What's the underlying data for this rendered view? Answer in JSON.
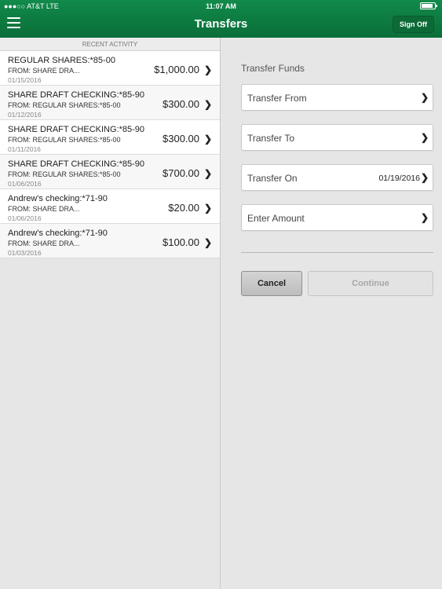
{
  "status_bar": {
    "carrier": "●●●○○ AT&T  LTE",
    "time": "11:07 AM",
    "battery_level": 0.85
  },
  "header": {
    "title": "Transfers",
    "sign_off_label": "Sign Off"
  },
  "recent_activity": {
    "title": "RECENT ACTIVITY",
    "items": [
      {
        "account": "REGULAR SHARES:*85-00",
        "from": "FROM: SHARE DRA...",
        "date": "01/15/2016",
        "amount": "$1,000.00"
      },
      {
        "account": "SHARE DRAFT CHECKING:*85-90",
        "from": "FROM: REGULAR SHARES:*85-00",
        "date": "01/12/2016",
        "amount": "$300.00"
      },
      {
        "account": "SHARE DRAFT CHECKING:*85-90",
        "from": "FROM: REGULAR SHARES:*85-00",
        "date": "01/11/2016",
        "amount": "$300.00"
      },
      {
        "account": "SHARE DRAFT CHECKING:*85-90",
        "from": "FROM: REGULAR SHARES:*85-00",
        "date": "01/06/2016",
        "amount": "$700.00"
      },
      {
        "account": "Andrew's checking:*71-90",
        "from": "FROM: SHARE DRA...",
        "date": "01/06/2016",
        "amount": "$20.00"
      },
      {
        "account": "Andrew's checking:*71-90",
        "from": "FROM: SHARE DRA...",
        "date": "01/03/2016",
        "amount": "$100.00"
      }
    ]
  },
  "form": {
    "title": "Transfer Funds",
    "transfer_from_label": "Transfer From",
    "transfer_to_label": "Transfer To",
    "transfer_on_label": "Transfer On",
    "transfer_on_value": "01/19/2016",
    "amount_label": "Enter Amount",
    "cancel_label": "Cancel",
    "continue_label": "Continue"
  },
  "colors": {
    "brand_green": "#0f7d43",
    "background": "#e6e6e6"
  }
}
